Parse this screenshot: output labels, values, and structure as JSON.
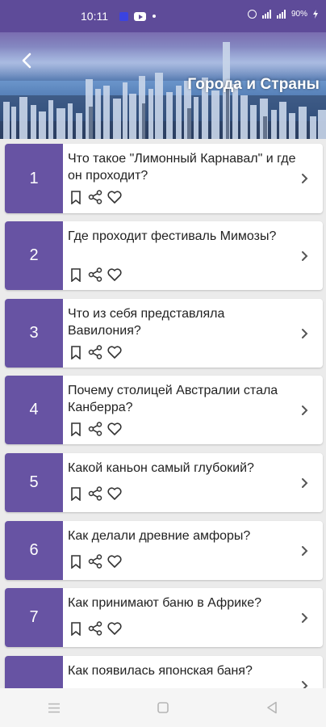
{
  "status_bar": {
    "time": "10:11",
    "battery": "90%"
  },
  "header": {
    "title": "Города и Страны",
    "back_icon": "chevron-left-icon"
  },
  "items": [
    {
      "number": "1",
      "question": "Что такое \"Лимонный Карнавал\" и где он проходит?"
    },
    {
      "number": "2",
      "question": "Где проходит фестиваль Мимозы?"
    },
    {
      "number": "3",
      "question": "Что из себя представляла Вавилония?"
    },
    {
      "number": "4",
      "question": "Почему столицей Австралии стала Канберра?"
    },
    {
      "number": "5",
      "question": "Какой каньон самый глубокий?"
    },
    {
      "number": "6",
      "question": "Как делали древние амфоры?"
    },
    {
      "number": "7",
      "question": "Как принимают баню в Африке?"
    },
    {
      "number": "8",
      "question": "Как появилась японская баня?"
    }
  ],
  "colors": {
    "accent": "#6753a3",
    "status_bar": "#5e4b99"
  }
}
